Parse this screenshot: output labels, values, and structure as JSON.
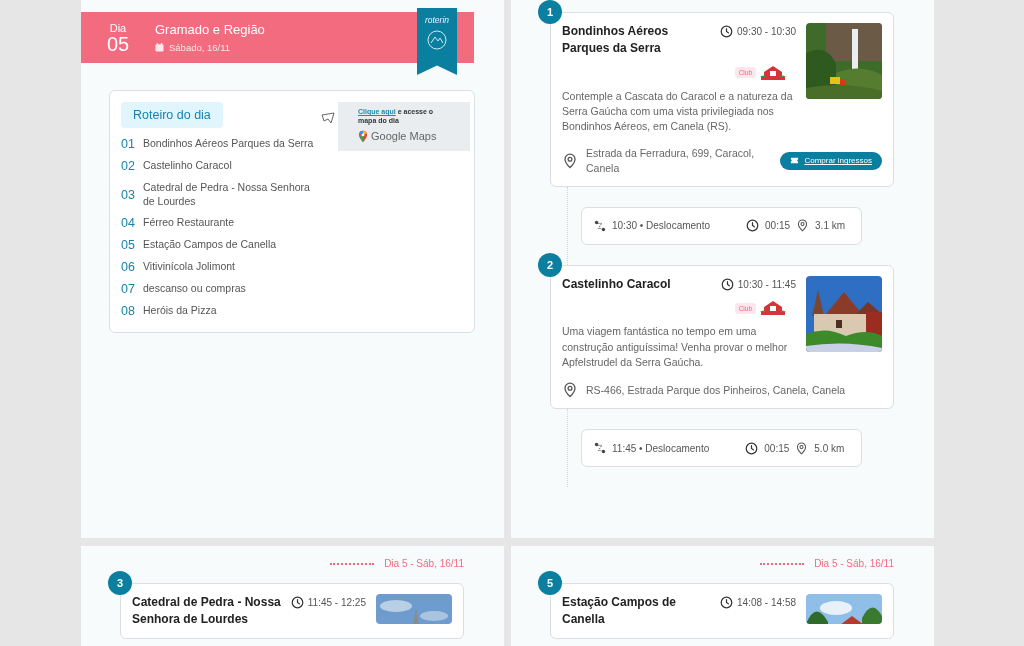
{
  "day_cover": {
    "day_label": "Dia",
    "day_number": "05",
    "title": "Gramado e Região",
    "date": "Sábado, 16/11",
    "logo_text": "roterin"
  },
  "summary": {
    "heading": "Roteiro do dia",
    "items": [
      {
        "number": "01",
        "name": "Bondinhos Aéreos Parques da Serra"
      },
      {
        "number": "02",
        "name": "Castelinho Caracol"
      },
      {
        "number": "03",
        "name": "Catedral de Pedra - Nossa Senhora de Lourdes"
      },
      {
        "number": "04",
        "name": "Férreo Restaurante"
      },
      {
        "number": "05",
        "name": "Estação Campos de Canella"
      },
      {
        "number": "06",
        "name": "Vitivinícola Jolimont"
      },
      {
        "number": "07",
        "name": "descanso ou compras"
      },
      {
        "number": "08",
        "name": "Heróis da Pizza"
      }
    ],
    "maps_promo": {
      "link": "Clique aqui",
      "text": "e acesse o mapa do dia",
      "brand": "Google Maps"
    }
  },
  "timeline": [
    {
      "kind": "stop",
      "number": "1",
      "title": "Bondinhos Aéreos Parques da Serra",
      "time": "09:30 - 10:30",
      "badge": "Club",
      "description": "Contemple a Cascata do Caracol e a natureza da Serra Gaúcha com uma vista privilegiada nos Bondinhos Aéreos, em Canela (RS).",
      "address": "Estrada da Ferradura, 699, Caracol, Canela",
      "button": "Comprar ingressos"
    },
    {
      "kind": "travel",
      "time": "10:30 • Deslocamento",
      "duration": "00:15",
      "distance": "3.1 km"
    },
    {
      "kind": "stop",
      "number": "2",
      "title": "Castelinho Caracol",
      "time": "10:30 - 11:45",
      "badge": "Club",
      "description": "Uma viagem fantástica no tempo em uma construção antiguíssima! Venha provar o melhor Apfelstrudel da Serra Gaúcha.",
      "address": "RS-466, Estrada Parque dos Pinheiros, Canela, Canela"
    },
    {
      "kind": "travel",
      "time": "11:45 • Deslocamento",
      "duration": "00:15",
      "distance": "5.0 km"
    }
  ],
  "next_pages": [
    {
      "header": "Dia 5 - Sáb, 16/11",
      "number": "3",
      "title": "Catedral de Pedra - Nossa Senhora de Lourdes",
      "time": "11:45 - 12:25"
    },
    {
      "header": "Dia 5 - Sáb, 16/11",
      "number": "5",
      "title": "Estação Campos de Canella",
      "time": "14:08 - 14:58"
    }
  ]
}
